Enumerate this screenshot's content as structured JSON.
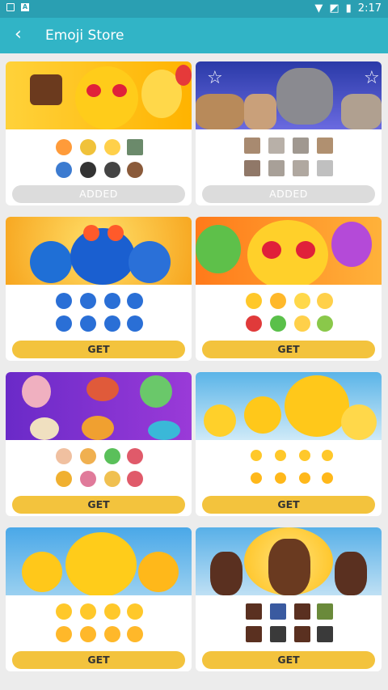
{
  "status": {
    "time": "2:17"
  },
  "header": {
    "back_icon": "back-arrow-icon",
    "title": "Emoji Store"
  },
  "cards": [
    {
      "button": "ADDED",
      "state": "added",
      "theme": "emoji-party"
    },
    {
      "button": "ADDED",
      "state": "added",
      "theme": "cats"
    },
    {
      "button": "GET",
      "state": "get",
      "theme": "blue-emoji"
    },
    {
      "button": "GET",
      "state": "get",
      "theme": "love-emoji"
    },
    {
      "button": "GET",
      "state": "get",
      "theme": "zodiac"
    },
    {
      "button": "GET",
      "state": "get",
      "theme": "laughing-emoji"
    },
    {
      "button": "GET",
      "state": "get",
      "theme": "angry-emoji"
    },
    {
      "button": "GET",
      "state": "get",
      "theme": "avatar-people"
    }
  ],
  "colors": {
    "accent": "#31b4c6",
    "statusbar": "#2a9fb2",
    "get": "#f3c33d",
    "added": "#dcdcdc"
  }
}
